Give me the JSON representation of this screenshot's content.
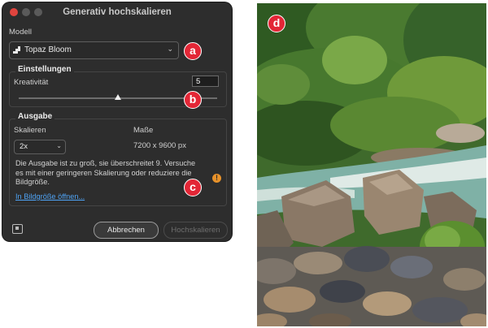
{
  "dialog": {
    "title": "Generativ hochskalieren",
    "model_label": "Modell",
    "model_value": "Topaz Bloom",
    "settings": {
      "heading": "Einstellungen",
      "creativity_label": "Kreativität",
      "creativity_value": "5",
      "slider_fraction": 0.5
    },
    "output": {
      "heading": "Ausgabe",
      "scale_label": "Skalieren",
      "scale_value": "2x",
      "size_label": "Maße",
      "size_value": "7200 x 9600 px",
      "warning_text": "Die Ausgabe ist zu groß, sie überschreitet 9. Versuche es mit einer geringeren Skalierung oder reduziere die Bildgröße.",
      "open_link": "In Bildgröße öffnen..."
    },
    "buttons": {
      "cancel": "Abbrechen",
      "upscale": "Hochskalieren"
    }
  },
  "callouts": {
    "a": "a",
    "b": "b",
    "c": "c",
    "d": "d"
  },
  "colors": {
    "callout_red": "#e32636",
    "warning_orange": "#e8922a",
    "link_blue": "#4ea3f5",
    "dialog_bg": "#2d2d2d"
  }
}
